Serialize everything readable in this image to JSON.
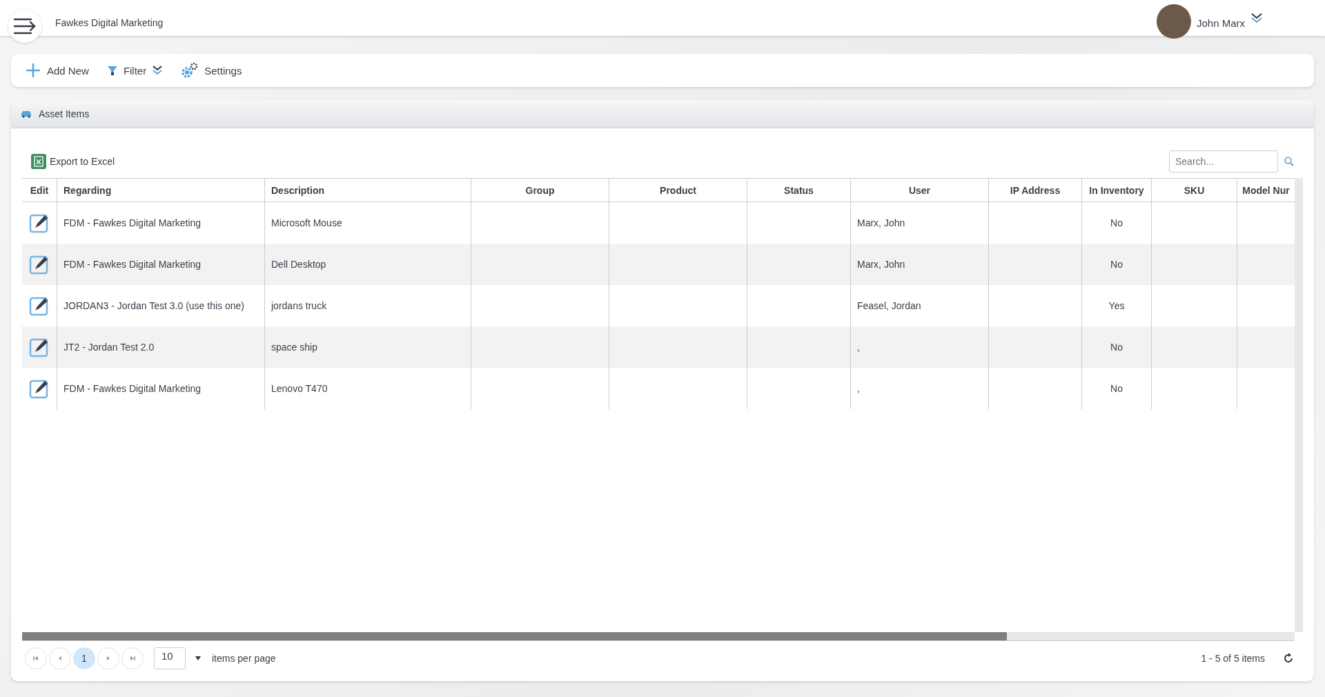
{
  "header": {
    "company": "Fawkes Digital Marketing",
    "user_name": "John Marx"
  },
  "toolbar": {
    "buttons": [
      "Add New",
      "Filter",
      "Settings"
    ]
  },
  "panel": {
    "title": "Asset Items"
  },
  "export": {
    "label": "Export to Excel"
  },
  "search": {
    "placeholder": "Search..."
  },
  "table": {
    "columns": [
      "Edit",
      "Regarding",
      "Description",
      "Group",
      "Product",
      "Status",
      "User",
      "IP Address",
      "In Inventory",
      "SKU",
      "Model Nur"
    ],
    "rows": [
      {
        "regarding": "FDM - Fawkes Digital Marketing",
        "description": "Microsoft Mouse",
        "user": "Marx, John",
        "in_inventory": "No"
      },
      {
        "regarding": "FDM - Fawkes Digital Marketing",
        "description": "Dell Desktop",
        "user": "Marx, John",
        "in_inventory": "No"
      },
      {
        "regarding": "JORDAN3 - Jordan Test 3.0 (use this one)",
        "description": "jordans truck",
        "user": "Feasel, Jordan",
        "in_inventory": "Yes"
      },
      {
        "regarding": "JT2 - Jordan Test 2.0",
        "description": "space ship",
        "user": ",",
        "in_inventory": "No"
      },
      {
        "regarding": "FDM - Fawkes Digital Marketing",
        "description": "Lenovo T470",
        "user": ",",
        "in_inventory": "No"
      }
    ]
  },
  "pager": {
    "pages": [
      {
        "label": "1",
        "selected": true
      }
    ],
    "page_size": "10",
    "per_page_label": "items per page",
    "summary": "1 - 5 of 5 items"
  }
}
